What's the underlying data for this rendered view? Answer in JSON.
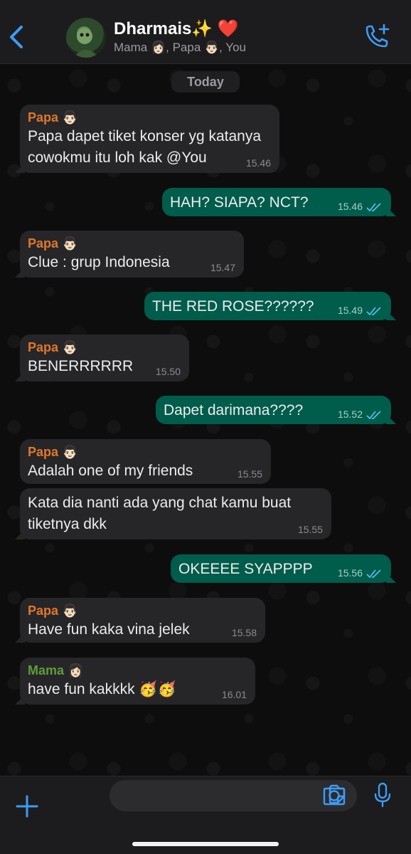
{
  "header": {
    "title": "Dharmais✨ ❤️",
    "subtitle": "Mama 👩🏻, Papa 👨🏻, You"
  },
  "date_divider": "Today",
  "messages": [
    {
      "from": "Papa 👨🏻",
      "dir": "in",
      "text_lines": [
        "Papa dapet tiket konser yg katanya",
        "cowokmu itu loh kak @You"
      ],
      "time": "15.46"
    },
    {
      "dir": "out",
      "text": "HAH? SIAPA? NCT?",
      "time": "15.46"
    },
    {
      "from": "Papa 👨🏻",
      "dir": "in",
      "text": "Clue : grup Indonesia",
      "time": "15.47"
    },
    {
      "dir": "out",
      "text": "THE RED ROSE??????",
      "time": "15.49"
    },
    {
      "from": "Papa 👨🏻",
      "dir": "in",
      "text": "BENERRRRRR",
      "time": "15.50"
    },
    {
      "dir": "out",
      "text": "Dapet darimana????",
      "time": "15.52"
    },
    {
      "from": "Papa 👨🏻",
      "dir": "in",
      "text": "Adalah one of my friends",
      "time": "15.55"
    },
    {
      "dir": "in",
      "text_lines": [
        "Kata dia nanti ada yang chat kamu buat",
        "tiketnya dkk"
      ],
      "time": "15.55"
    },
    {
      "dir": "out",
      "text": "OKEEEE SYAPPPP",
      "time": "15.56"
    },
    {
      "from": "Papa 👨🏻",
      "dir": "in",
      "text": "Have fun kaka vina jelek",
      "time": "15.58"
    },
    {
      "from": "Mama 👩🏻",
      "dir": "in",
      "text": "have fun kakkkk 🥳🥳",
      "time": "16.01"
    }
  ],
  "input": {
    "value": "",
    "placeholder": ""
  },
  "icons": [
    "chevron-left-icon",
    "add-call-icon",
    "plus-icon",
    "sticker-icon",
    "camera-icon",
    "microphone-icon",
    "read-receipt-icon"
  ],
  "colors": {
    "accent": "#3d9cf5",
    "outgoing_bubble": "#005c4b",
    "incoming_bubble": "#262628",
    "papa_name": "#e0782a",
    "mama_name": "#5f9d3a"
  }
}
